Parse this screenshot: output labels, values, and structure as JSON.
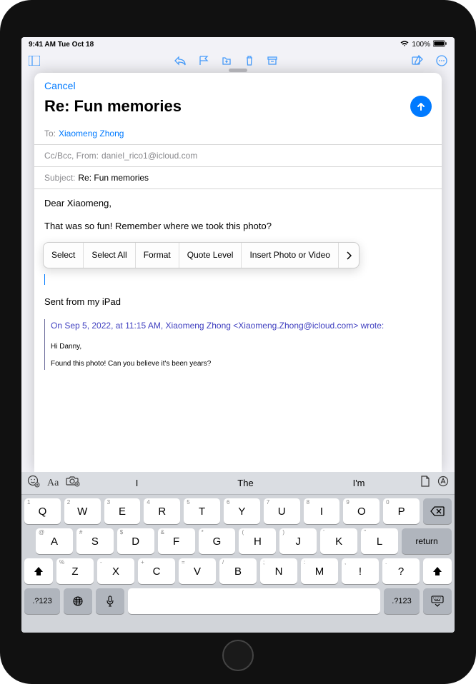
{
  "status_bar": {
    "time": "9:41 AM  Tue Oct 18",
    "wifi": "wifi",
    "battery_pct": "100%"
  },
  "compose": {
    "cancel": "Cancel",
    "title": "Re: Fun memories",
    "send_icon": "arrow.up",
    "to_label": "To:",
    "to_value": "Xiaomeng Zhong",
    "cc_label": "Cc/Bcc, From:",
    "cc_value": "daniel_rico1@icloud.com",
    "subject_label": "Subject:",
    "subject_value": "Re: Fun memories",
    "body_greeting": "Dear Xiaomeng,",
    "body_line": "That was so fun! Remember where we took this photo?",
    "context_menu": {
      "select": "Select",
      "select_all": "Select All",
      "format": "Format",
      "quote_level": "Quote Level",
      "insert_photo": "Insert Photo or Video"
    },
    "signature": "Sent from my iPad",
    "quote_header": "On Sep 5, 2022, at 11:15 AM, Xiaomeng Zhong <Xiaomeng.Zhong@icloud.com> wrote:",
    "quote_body_1": "Hi Danny,",
    "quote_body_2": "Found this photo! Can you believe it's been years?"
  },
  "keyboard": {
    "suggestions": {
      "s1": "I",
      "s2": "The",
      "s3": "I'm"
    },
    "row1": {
      "k1": "Q",
      "k2": "W",
      "k3": "E",
      "k4": "R",
      "k5": "T",
      "k6": "Y",
      "k7": "U",
      "k8": "I",
      "k9": "O",
      "k10": "P",
      "a1": "1",
      "a2": "2",
      "a3": "3",
      "a4": "4",
      "a5": "5",
      "a6": "6",
      "a7": "7",
      "a8": "8",
      "a9": "9",
      "a10": "0"
    },
    "row2": {
      "k1": "A",
      "k2": "S",
      "k3": "D",
      "k4": "F",
      "k5": "G",
      "k6": "H",
      "k7": "J",
      "k8": "K",
      "k9": "L",
      "a1": "@",
      "a2": "#",
      "a3": "$",
      "a4": "&",
      "a5": "*",
      "a6": "(",
      "a7": ")",
      "a8": "'",
      "a9": "\"",
      "return": "return"
    },
    "row3": {
      "k1": "Z",
      "k2": "X",
      "k3": "C",
      "k4": "V",
      "k5": "B",
      "k6": "N",
      "k7": "M",
      "k8": "!",
      "k9": "?",
      "a1": "%",
      "a2": "-",
      "a3": "+",
      "a4": "=",
      "a5": "/",
      "a6": ";",
      "a7": ":",
      "a8": ",",
      "a9": "."
    },
    "row4": {
      "num": ".?123"
    }
  }
}
